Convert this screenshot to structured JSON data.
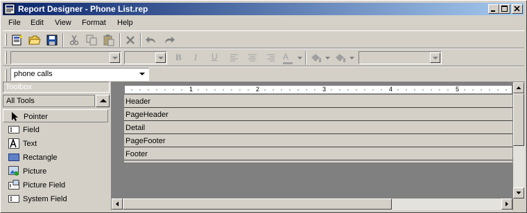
{
  "window": {
    "title": "Report Designer - Phone List.rep"
  },
  "menu": [
    "File",
    "Edit",
    "View",
    "Format",
    "Help"
  ],
  "toolbar": {
    "icons": [
      "new-report-icon",
      "open-folder-icon",
      "save-icon",
      "cut-icon",
      "copy-icon",
      "paste-icon",
      "delete-icon",
      "undo-icon",
      "redo-icon"
    ]
  },
  "format_toolbar": {
    "bold": "B",
    "italic": "I",
    "underline": "U",
    "font_color_glyph": "A"
  },
  "datasource": {
    "value": "phone calls"
  },
  "toolbox": {
    "title": "Toolbox",
    "category": "All Tools",
    "tools": [
      {
        "label": "Pointer",
        "icon": "pointer-icon"
      },
      {
        "label": "Field",
        "icon": "field-icon"
      },
      {
        "label": "Text",
        "icon": "text-icon"
      },
      {
        "label": "Rectangle",
        "icon": "rectangle-icon"
      },
      {
        "label": "Picture",
        "icon": "picture-icon"
      },
      {
        "label": "Picture Field",
        "icon": "picture-field-icon"
      },
      {
        "label": "System Field",
        "icon": "system-field-icon"
      }
    ]
  },
  "ruler": {
    "marks": [
      "1",
      "2",
      "3",
      "4",
      "5"
    ]
  },
  "bands": [
    "Header",
    "PageHeader",
    "Detail",
    "PageFooter",
    "Footer"
  ],
  "colors": {
    "title_bar_start": "#0a246a",
    "title_bar_end": "#a6caf0",
    "face": "#d4d0c8",
    "workspace": "#808080"
  }
}
